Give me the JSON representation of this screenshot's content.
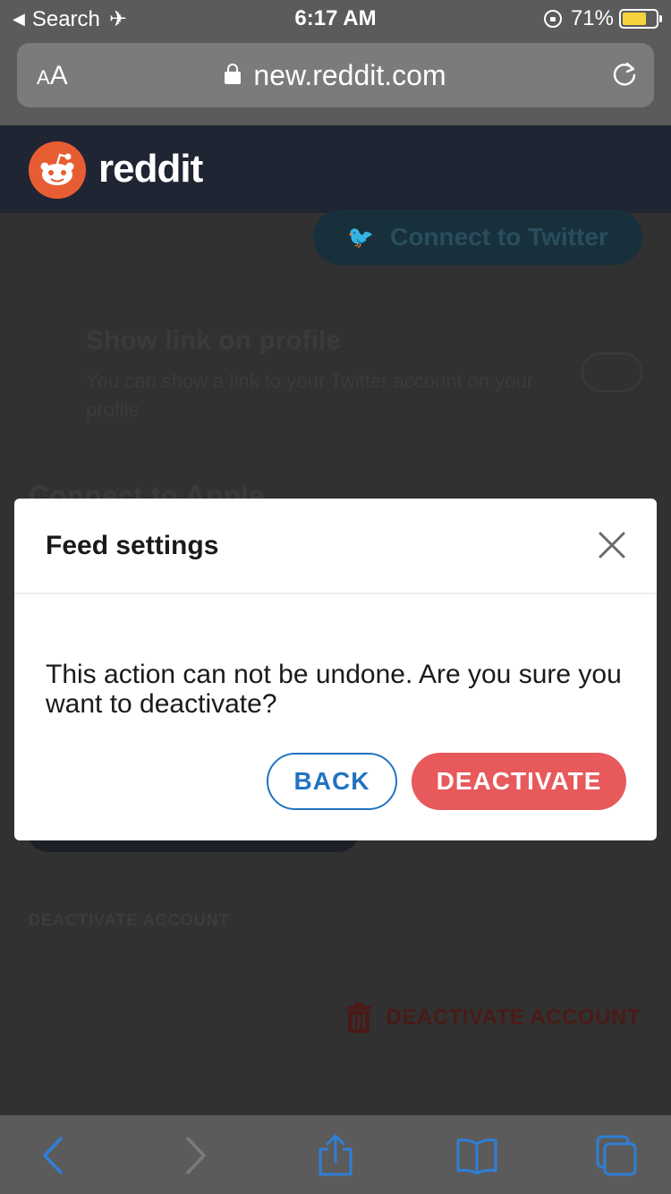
{
  "status_bar": {
    "back_app": "Search",
    "time": "6:17 AM",
    "battery": "71%",
    "battery_level": 0.71,
    "battery_color": "#f5d33e"
  },
  "browser": {
    "text_size_small": "A",
    "text_size_large": "A",
    "url": "new.reddit.com"
  },
  "site": {
    "brand": "reddit",
    "brand_color": "#e75d33"
  },
  "page": {
    "twitter_button": "Connect to Twitter",
    "show_link_title": "Show link on profile",
    "show_link_desc": "You can show a link to your Twitter account on your profile",
    "connect_apple_heading": "Connect to Apple",
    "deactivate_heading": "DEACTIVATE ACCOUNT",
    "deactivate_link": "DEACTIVATE ACCOUNT"
  },
  "modal": {
    "title": "Feed settings",
    "message": "This action can not be undone. Are you sure you want to deactivate?",
    "back_label": "BACK",
    "deactivate_label": "DEACTIVATE",
    "accent_color": "#2272c1",
    "danger_color": "#e7595b"
  },
  "toolbar": {
    "icons": [
      "back-icon",
      "forward-icon",
      "share-icon",
      "bookmarks-icon",
      "tabs-icon"
    ]
  }
}
